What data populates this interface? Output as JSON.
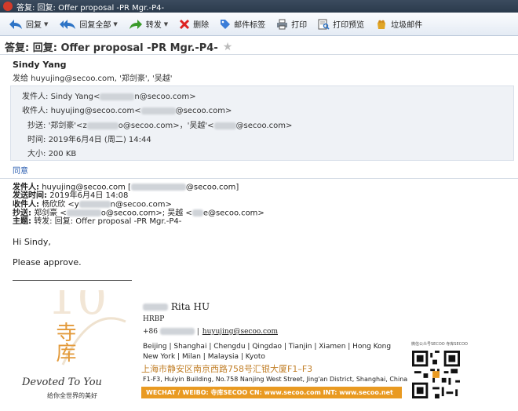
{
  "window": {
    "title": "答复: 回复: Offer proposal -PR Mgr.-P4-"
  },
  "toolbar": {
    "reply": "回复",
    "reply_all": "回复全部",
    "forward": "转发",
    "delete": "删除",
    "tag": "邮件标签",
    "print": "打印",
    "print_preview": "打印预览",
    "junk": "垃圾邮件"
  },
  "message": {
    "subject": "答复: 回复: Offer proposal -PR Mgr.-P4-",
    "sender_name": "Sindy Yang",
    "sent_to": "发给 huyujing@secoo.com, '郑剑豪', '吴越'",
    "details": {
      "from_label": "发件人:",
      "from_value": "Sindy Yang<",
      "from_tail": "n@secoo.com>",
      "to_label": "收件人:",
      "to_value": "huyujing@secoo.com<",
      "to_tail": "@secoo.com>",
      "cc_label": "抄送:",
      "cc_value": "'郑剑豪'<z",
      "cc_mid": "o@secoo.com>，'吴越'<",
      "cc_tail": "@secoo.com>",
      "time_label": "时间:",
      "time_value": "2019年6月4日 (周二) 14:44",
      "size_label": "大小:",
      "size_value": "200 KB"
    },
    "collapse_link": "同意",
    "forwarded": {
      "from_label": "发件人:",
      "from_value": "huyujing@secoo.com [",
      "from_tail": "@secoo.com]",
      "sent_label": "发送时间:",
      "sent_value": "2019年6月4日 14:08",
      "to_label": "收件人:",
      "to_value": "杨欣欣 <y",
      "to_tail": "n@secoo.com>",
      "cc_label": "抄送:",
      "cc_value": "郑剑豪 <",
      "cc_mid": "o@secoo.com>; 吴越 <",
      "cc_tail": "e@secoo.com>",
      "subject_label": "主题:",
      "subject_value": "转发: 回复: Offer proposal -PR Mgr.-P4-"
    },
    "greeting": "Hi Sindy,",
    "body": "Please approve."
  },
  "signature": {
    "name": "Rita HU",
    "title": "HRBP",
    "phone_prefix": "+86",
    "email": "huyujing@secoo.com",
    "cities_1": "Beijing | Shanghai | Chengdu | Qingdao | Tianjin | Xiamen | Hong Kong",
    "cities_2": "New York | Milan | Malaysia | Kyoto",
    "address_cn": "上海市静安区南京西路758号汇银大厦F1–F3",
    "address_en": "F1-F3, Huiyin Building, No.758 Nanjing West Street, Jing'an District, Shanghai, China",
    "bar_text": "WECHAT / WEIBO: 寺库SECOO   CN: www.secoo.com   INT: www.secoo.net",
    "logo_cn": "寺库",
    "logo_en": "Devoted To You",
    "logo_tagline": "给你全世界的美好",
    "qr_caption": "微信公众号SECOO 寺库SECOO"
  },
  "colors": {
    "accent_blue": "#2a5db0",
    "brand_orange": "#e99a21",
    "address_gold": "#c2802a"
  }
}
